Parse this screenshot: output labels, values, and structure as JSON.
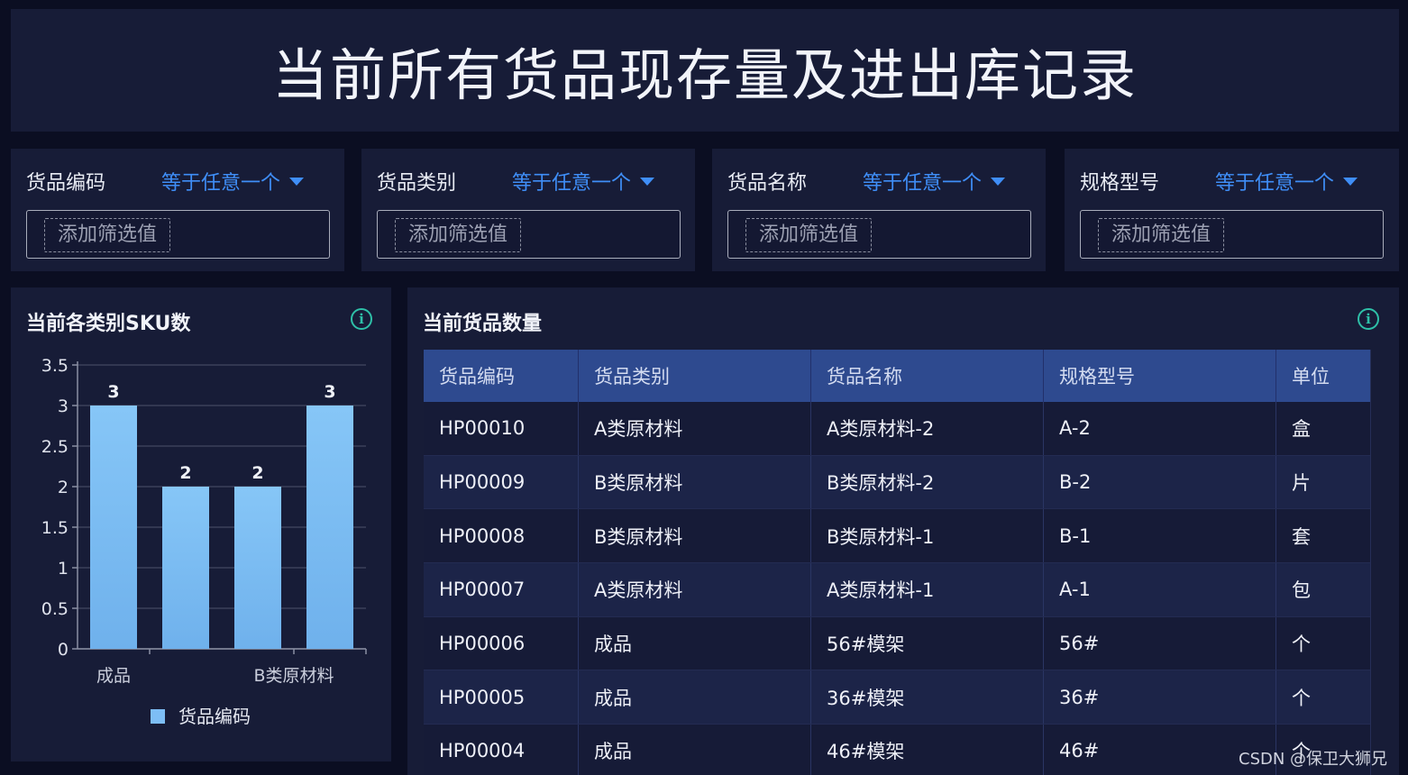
{
  "header": {
    "title": "当前所有货品现存量及进出库记录"
  },
  "filters": [
    {
      "label": "货品编码",
      "operator": "等于任意一个",
      "placeholder": "添加筛选值"
    },
    {
      "label": "货品类别",
      "operator": "等于任意一个",
      "placeholder": "添加筛选值"
    },
    {
      "label": "货品名称",
      "operator": "等于任意一个",
      "placeholder": "添加筛选值"
    },
    {
      "label": "规格型号",
      "operator": "等于任意一个",
      "placeholder": "添加筛选值"
    }
  ],
  "chart_panel": {
    "title": "当前各类别SKU数",
    "info_icon": "info-icon"
  },
  "chart_data": {
    "type": "bar",
    "title": "当前各类别SKU数",
    "x_tick_labels": [
      "成品",
      "B类原材料"
    ],
    "values": [
      3,
      2,
      2,
      3
    ],
    "data_labels": [
      "3",
      "2",
      "2",
      "3"
    ],
    "ylim": [
      0,
      3.5
    ],
    "y_ticks": [
      "0",
      "0.5",
      "1",
      "1.5",
      "2",
      "2.5",
      "3",
      "3.5"
    ],
    "series": [
      {
        "name": "货品编码",
        "values": [
          3,
          2,
          2,
          3
        ]
      }
    ],
    "bar_color": "#7dbef5",
    "grid": true,
    "legend_position": "bottom"
  },
  "table_panel": {
    "title": "当前货品数量",
    "info_icon": "info-icon",
    "columns": [
      "货品编码",
      "货品类别",
      "货品名称",
      "规格型号",
      "单位"
    ],
    "rows": [
      [
        "HP00010",
        "A类原材料",
        "A类原材料-2",
        "A-2",
        "盒"
      ],
      [
        "HP00009",
        "B类原材料",
        "B类原材料-2",
        "B-2",
        "片"
      ],
      [
        "HP00008",
        "B类原材料",
        "B类原材料-1",
        "B-1",
        "套"
      ],
      [
        "HP00007",
        "A类原材料",
        "A类原材料-1",
        "A-1",
        "包"
      ],
      [
        "HP00006",
        "成品",
        "56#模架",
        "56#",
        "个"
      ],
      [
        "HP00005",
        "成品",
        "36#模架",
        "36#",
        "个"
      ],
      [
        "HP00004",
        "成品",
        "46#模架",
        "46#",
        "个"
      ]
    ]
  },
  "watermark": "CSDN @保卫大狮兄",
  "colors": {
    "accent": "#3f8ef7",
    "header_bg": "#2e4a8f",
    "panel_bg": "#171c37",
    "info": "#2ec0a8"
  }
}
